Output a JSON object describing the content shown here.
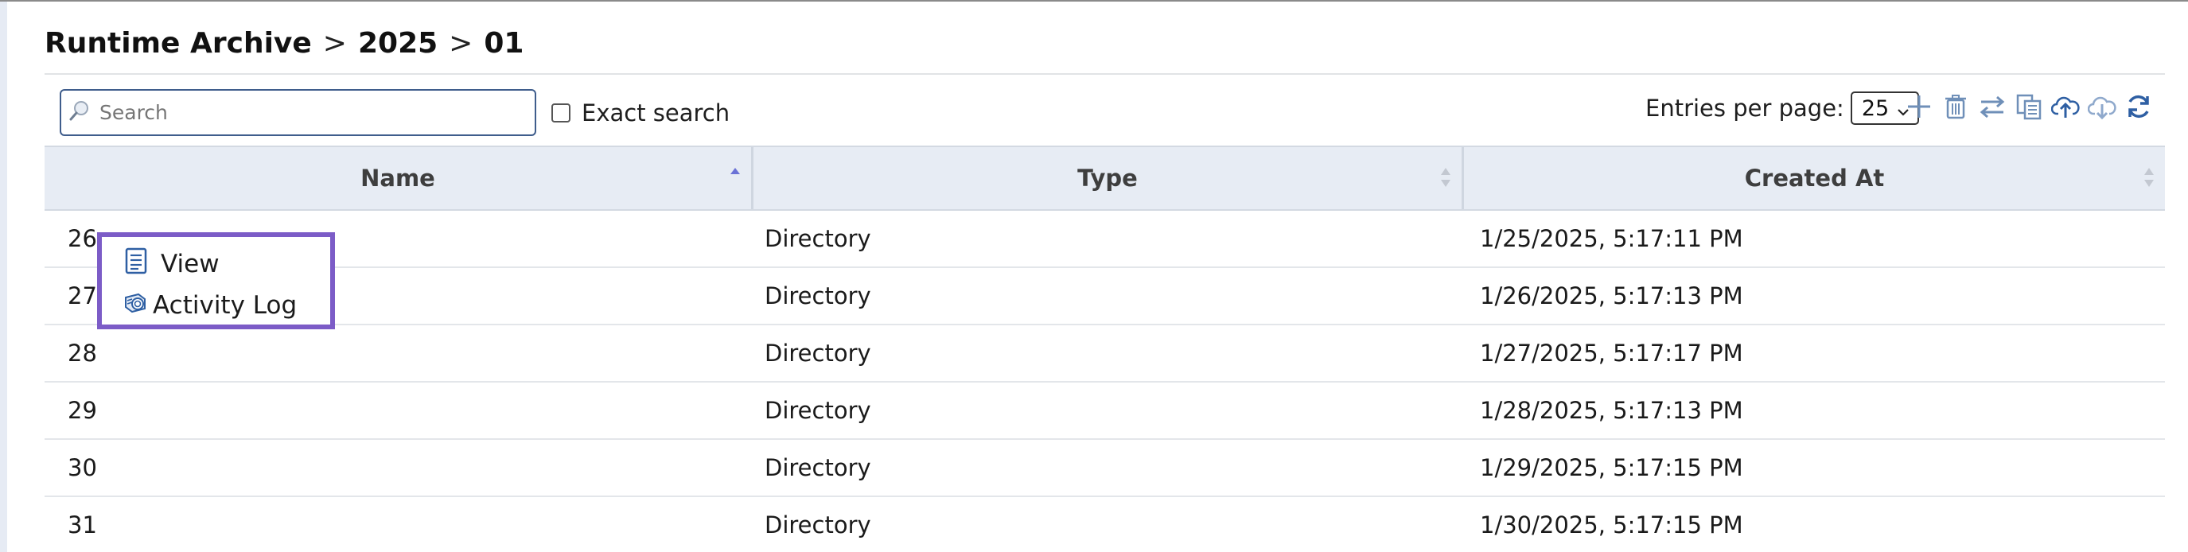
{
  "breadcrumb": {
    "items": [
      "Runtime Archive",
      "2025",
      "01"
    ],
    "separator": ">"
  },
  "search": {
    "placeholder": "Search",
    "value": "",
    "exact_label": "Exact search",
    "exact_checked": false
  },
  "entries": {
    "label": "Entries per page:",
    "value": "25"
  },
  "toolbar": {
    "icons": [
      "add-icon",
      "delete-icon",
      "move-icon",
      "copy-icon",
      "upload-icon",
      "download-icon",
      "refresh-icon"
    ]
  },
  "table": {
    "columns": [
      {
        "label": "Name",
        "sort": "ascending"
      },
      {
        "label": "Type",
        "sort": "none"
      },
      {
        "label": "Created At",
        "sort": "none"
      }
    ],
    "rows": [
      {
        "name": "26",
        "type": "Directory",
        "created": "1/25/2025, 5:17:11 PM"
      },
      {
        "name": "27",
        "type": "Directory",
        "created": "1/26/2025, 5:17:13 PM"
      },
      {
        "name": "28",
        "type": "Directory",
        "created": "1/27/2025, 5:17:17 PM"
      },
      {
        "name": "29",
        "type": "Directory",
        "created": "1/28/2025, 5:17:13 PM"
      },
      {
        "name": "30",
        "type": "Directory",
        "created": "1/29/2025, 5:17:15 PM"
      },
      {
        "name": "31",
        "type": "Directory",
        "created": "1/30/2025, 5:17:15 PM"
      }
    ]
  },
  "context_menu": {
    "items": [
      {
        "label": "View",
        "icon": "document-icon"
      },
      {
        "label": "Activity Log",
        "icon": "activity-log-icon"
      }
    ]
  },
  "colors": {
    "accent": "#7c5cc7",
    "icon_blue": "#6f8fb8",
    "icon_dark_blue": "#2e5fa3",
    "header_bg": "#e7ecf4"
  }
}
